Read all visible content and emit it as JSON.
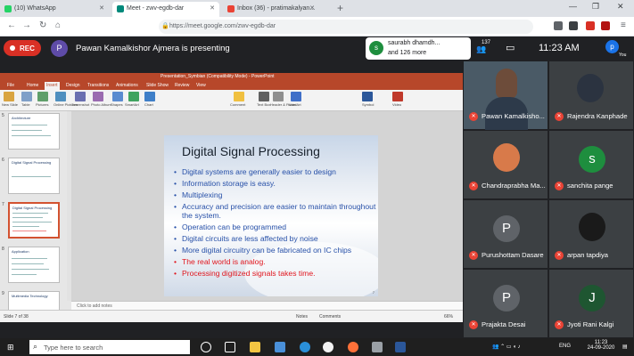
{
  "browser": {
    "tabs": [
      {
        "label": "(10) WhatsApp",
        "icon": "whatsapp-icon",
        "color": "#25d366"
      },
      {
        "label": "Meet - zwv-egdb-dar",
        "icon": "meet-icon",
        "color": "#00897b"
      },
      {
        "label": "Inbox (36) - pratimakalyan...",
        "icon": "gmail-icon",
        "color": "#ea4335"
      }
    ],
    "url": "https://meet.google.com/zwv-egdb-dar"
  },
  "meet": {
    "rec_label": "REC",
    "presenter_initial": "P",
    "presenting_text": "Pawan Kamalkishor Ajmera is presenting",
    "chat_initial": "s",
    "chat_line1": "saurabh dhamdh...",
    "chat_line2": "and 126 more",
    "people_count": "137",
    "time": "11:23 AM",
    "you_initial": "p",
    "you_label": "You"
  },
  "ppt": {
    "title": "Presentation_Symbian (Compatibility Mode) - PowerPoint",
    "tabs": [
      "File",
      "Home",
      "Insert",
      "Design",
      "Transitions",
      "Animations",
      "Slide Show",
      "Review",
      "View"
    ],
    "active_tab": "Insert",
    "ribbon": [
      "New Slide",
      "Table",
      "Pictures",
      "Online Pictures",
      "Screenshot",
      "Photo Album",
      "Shapes",
      "SmartArt",
      "Chart",
      "Comment",
      "Text Box",
      "Header & Footer",
      "WordArt",
      "Symbol",
      "Video"
    ],
    "thumbnails": [
      {
        "num": "5",
        "title": "Architecture"
      },
      {
        "num": "6",
        "title": "Digital Signal Processing"
      },
      {
        "num": "7",
        "title": "Digital Signal Processing"
      },
      {
        "num": "8",
        "title": "Application"
      },
      {
        "num": "9",
        "title": "Multimedia Technology"
      }
    ],
    "notes_placeholder": "Click to add notes",
    "status_left": "Slide 7 of 38",
    "status_notes": "Notes",
    "status_comments": "Comments",
    "zoom": "66%"
  },
  "slide": {
    "title": "Digital Signal Processing",
    "bullets": [
      {
        "text": "Digital systems are generally easier to design",
        "color": "blue"
      },
      {
        "text": "Information storage is easy.",
        "color": "blue"
      },
      {
        "text": "Multiplexing",
        "color": "blue"
      },
      {
        "text": "Accuracy and precision are easier to maintain throughout the system.",
        "color": "blue"
      },
      {
        "text": "Operation can be programmed",
        "color": "blue"
      },
      {
        "text": "Digital circuits are less affected by noise",
        "color": "blue"
      },
      {
        "text": "More digital circuitry can be fabricated on IC chips",
        "color": "blue"
      },
      {
        "text": "The real world is analog.",
        "color": "red"
      },
      {
        "text": "Processing digitized signals takes time.",
        "color": "red"
      }
    ],
    "page": "7"
  },
  "participants": [
    {
      "name": "Pawan Kamalkisho...",
      "initial": "",
      "type": "video",
      "color": "#4a5a66"
    },
    {
      "name": "Rajendra Kanphade",
      "initial": "",
      "type": "photo",
      "color": "#2b3340"
    },
    {
      "name": "Chandraprabha Ma...",
      "initial": "",
      "type": "photo",
      "color": "#d87a4a"
    },
    {
      "name": "sanchita pange",
      "initial": "s",
      "type": "avatar",
      "color": "#1e8e3e"
    },
    {
      "name": "Purushottam Dasare",
      "initial": "P",
      "type": "avatar",
      "color": "#5f6368"
    },
    {
      "name": "arpan tapdiya",
      "initial": "",
      "type": "photo",
      "color": "#1a1a1a"
    },
    {
      "name": "Prajakta Desai",
      "initial": "P",
      "type": "avatar",
      "color": "#5f6368"
    },
    {
      "name": "Jyoti Rani Kalgi",
      "initial": "J",
      "type": "avatar",
      "color": "#1e5631"
    }
  ],
  "taskbar": {
    "search_placeholder": "Type here to search",
    "lang": "ENG",
    "time": "11:23",
    "date": "24-09-2020"
  }
}
